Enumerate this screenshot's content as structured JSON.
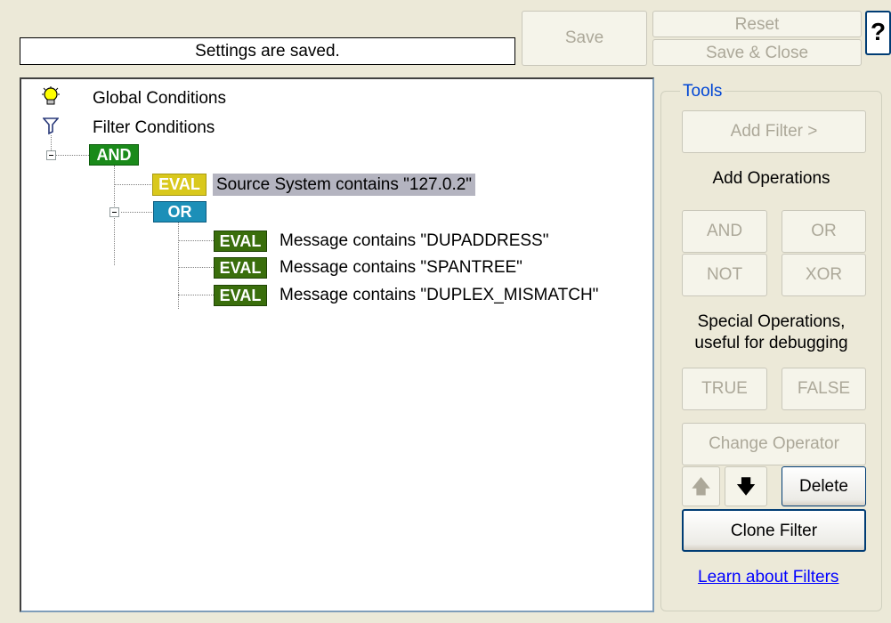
{
  "status_text": "Settings are saved.",
  "buttons": {
    "save": "Save",
    "reset": "Reset",
    "save_close": "Save & Close",
    "help": "?"
  },
  "tree": {
    "global_conditions": "Global Conditions",
    "filter_conditions": "Filter Conditions",
    "and_badge": "AND",
    "or_badge": "OR",
    "eval_badge": "EVAL",
    "items": [
      "Source System contains \"127.0.2\"",
      "Message contains \"DUPADDRESS\"",
      "Message contains \"SPANTREE\"",
      "Message contains \"DUPLEX_MISMATCH\""
    ]
  },
  "tools": {
    "title": "Tools",
    "add_filter": "Add Filter >",
    "add_operations": "Add Operations",
    "and": "AND",
    "or": "OR",
    "not": "NOT",
    "xor": "XOR",
    "special_ops_line1": "Special Operations,",
    "special_ops_line2": "useful for debugging",
    "true": "TRUE",
    "false": "FALSE",
    "change_operator": "Change Operator",
    "up_arrow": "🡅",
    "down_arrow": "🡇",
    "delete": "Delete",
    "clone_filter": "Clone Filter",
    "learn_link": "Learn about Filters"
  },
  "icons": [
    "lightbulb-icon",
    "funnel-icon",
    "help-icon",
    "arrow-up-icon",
    "arrow-down-icon"
  ]
}
